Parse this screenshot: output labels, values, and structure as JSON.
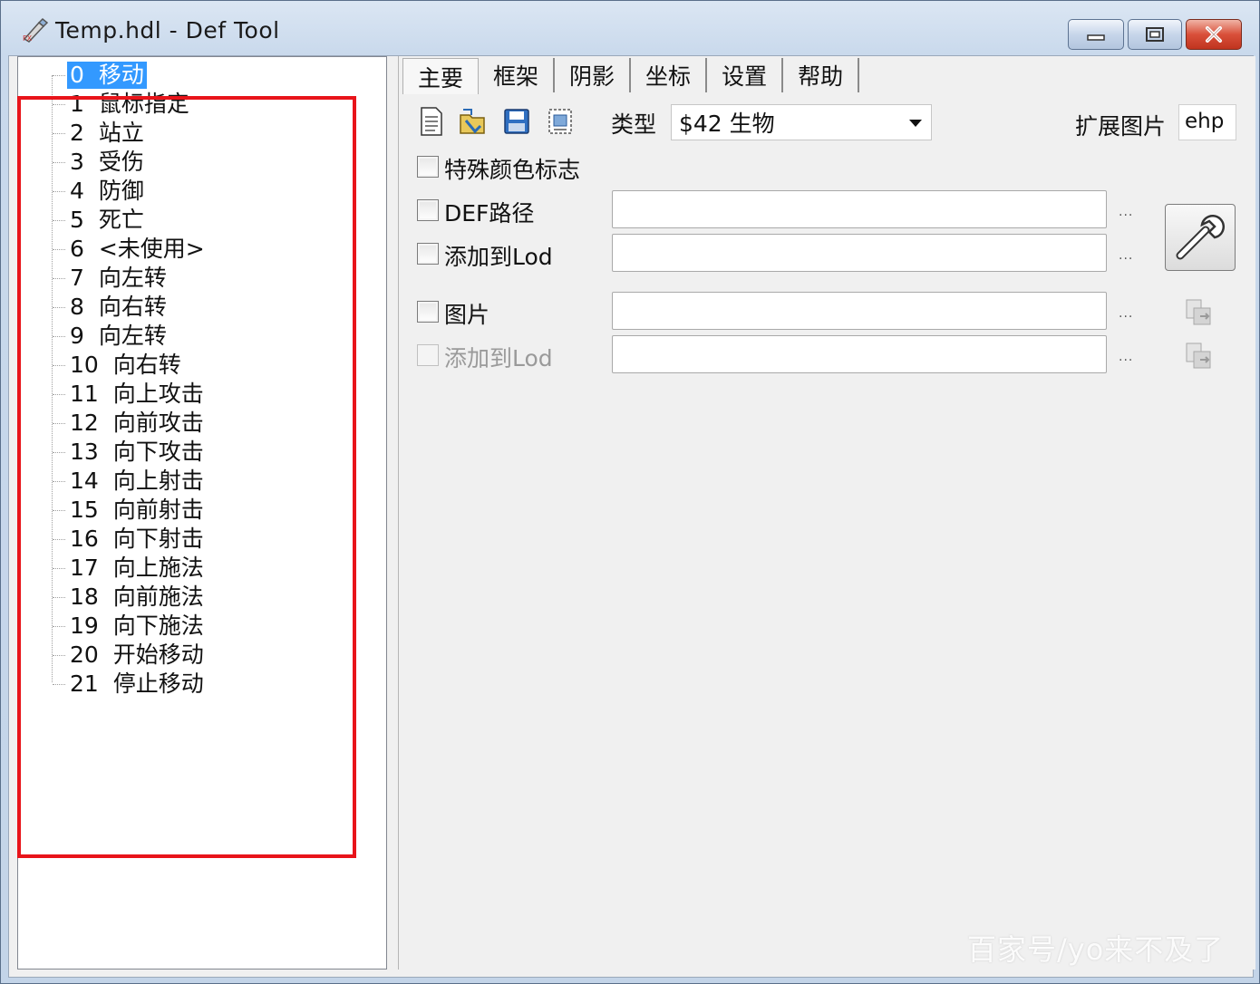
{
  "window": {
    "title": "Temp.hdl - Def Tool",
    "controls": {
      "minimize": "minimize-icon",
      "maximize": "maximize-icon",
      "close": "close-icon"
    }
  },
  "tree": {
    "selected_index": 0,
    "items": [
      {
        "num": "0",
        "label": "移动"
      },
      {
        "num": "1",
        "label": "鼠标指定"
      },
      {
        "num": "2",
        "label": "站立"
      },
      {
        "num": "3",
        "label": "受伤"
      },
      {
        "num": "4",
        "label": "防御"
      },
      {
        "num": "5",
        "label": "死亡"
      },
      {
        "num": "6",
        "label": "<未使用>"
      },
      {
        "num": "7",
        "label": "向左转"
      },
      {
        "num": "8",
        "label": "向右转"
      },
      {
        "num": "9",
        "label": "向左转"
      },
      {
        "num": "10",
        "label": "向右转"
      },
      {
        "num": "11",
        "label": "向上攻击"
      },
      {
        "num": "12",
        "label": "向前攻击"
      },
      {
        "num": "13",
        "label": "向下攻击"
      },
      {
        "num": "14",
        "label": "向上射击"
      },
      {
        "num": "15",
        "label": "向前射击"
      },
      {
        "num": "16",
        "label": "向下射击"
      },
      {
        "num": "17",
        "label": "向上施法"
      },
      {
        "num": "18",
        "label": "向前施法"
      },
      {
        "num": "19",
        "label": "向下施法"
      },
      {
        "num": "20",
        "label": "开始移动"
      },
      {
        "num": "21",
        "label": "停止移动"
      }
    ]
  },
  "tabs": [
    "主要",
    "框架",
    "阴影",
    "坐标",
    "设置",
    "帮助"
  ],
  "main": {
    "type_label": "类型",
    "type_value": "$42 生物",
    "ext_label": "扩展图片",
    "ext_value": "ehp",
    "special_color_label": "特殊颜色标志",
    "def_path_label": "DEF路径",
    "add_to_lod_label": "添加到Lod",
    "image_label": "图片",
    "add_to_lod2_label": "添加到Lod",
    "ellipsis": "..."
  },
  "watermark": "百家号/yo来不及了",
  "colors": {
    "selection": "#3399ff",
    "highlight_box": "#e8141a"
  }
}
